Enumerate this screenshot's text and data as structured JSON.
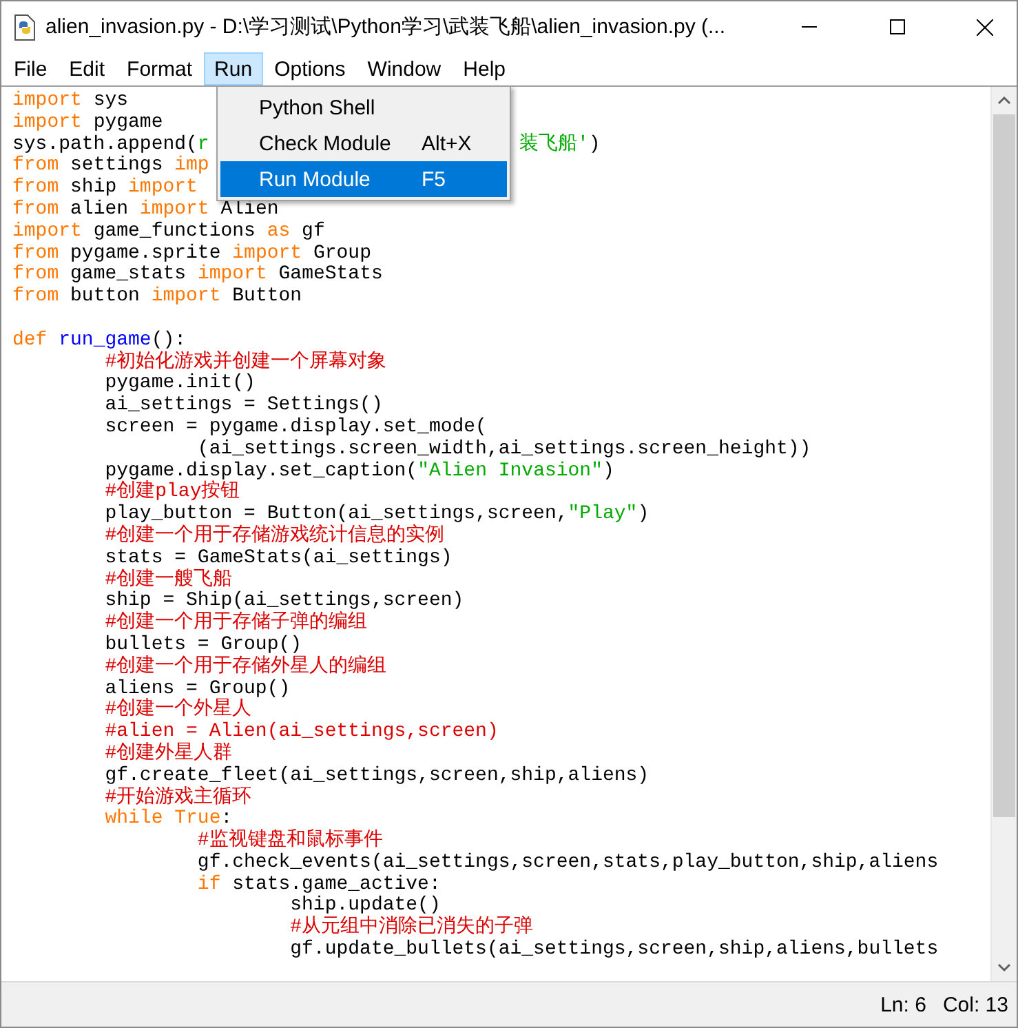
{
  "window": {
    "title": "alien_invasion.py - D:\\学习测试\\Python学习\\武装飞船\\alien_invasion.py (..."
  },
  "menu_bar": [
    {
      "label": "File",
      "selected": false
    },
    {
      "label": "Edit",
      "selected": false
    },
    {
      "label": "Format",
      "selected": false
    },
    {
      "label": "Run",
      "selected": true
    },
    {
      "label": "Options",
      "selected": false
    },
    {
      "label": "Window",
      "selected": false
    },
    {
      "label": "Help",
      "selected": false
    }
  ],
  "run_menu": [
    {
      "label": "Python Shell",
      "selected": false
    },
    {
      "label": "Check Module",
      "shortcut": "Alt+X",
      "selected": false
    },
    {
      "label": "Run Module",
      "shortcut": "F5",
      "selected": true
    }
  ],
  "code_lines": [
    {
      "tokens": [
        {
          "kind": "keyword",
          "text": "import"
        },
        {
          "kind": "plain",
          "text": " sys"
        }
      ]
    },
    {
      "tokens": [
        {
          "kind": "keyword",
          "text": "import"
        },
        {
          "kind": "plain",
          "text": " pygame"
        }
      ]
    },
    {
      "tokens": [
        {
          "kind": "plain",
          "text": "sys.path.append("
        },
        {
          "kind": "string",
          "text": "r"
        }
      ],
      "after_menu": [
        {
          "kind": "string",
          "text": "装飞船'"
        },
        {
          "kind": "plain",
          "text": ")"
        }
      ]
    },
    {
      "tokens": [
        {
          "kind": "keyword",
          "text": "from"
        },
        {
          "kind": "plain",
          "text": " settings "
        },
        {
          "kind": "keyword",
          "text": "imp"
        }
      ]
    },
    {
      "tokens": [
        {
          "kind": "keyword",
          "text": "from"
        },
        {
          "kind": "plain",
          "text": " ship "
        },
        {
          "kind": "keyword",
          "text": "import"
        }
      ]
    },
    {
      "tokens": [
        {
          "kind": "keyword",
          "text": "from"
        },
        {
          "kind": "plain",
          "text": " alien "
        },
        {
          "kind": "keyword",
          "text": "import"
        },
        {
          "kind": "plain",
          "text": " Alien"
        }
      ]
    },
    {
      "tokens": [
        {
          "kind": "keyword",
          "text": "import"
        },
        {
          "kind": "plain",
          "text": " game_functions "
        },
        {
          "kind": "keyword",
          "text": "as"
        },
        {
          "kind": "plain",
          "text": " gf"
        }
      ]
    },
    {
      "tokens": [
        {
          "kind": "keyword",
          "text": "from"
        },
        {
          "kind": "plain",
          "text": " pygame.sprite "
        },
        {
          "kind": "keyword",
          "text": "import"
        },
        {
          "kind": "plain",
          "text": " Group"
        }
      ]
    },
    {
      "tokens": [
        {
          "kind": "keyword",
          "text": "from"
        },
        {
          "kind": "plain",
          "text": " game_stats "
        },
        {
          "kind": "keyword",
          "text": "import"
        },
        {
          "kind": "plain",
          "text": " GameStats"
        }
      ]
    },
    {
      "tokens": [
        {
          "kind": "keyword",
          "text": "from"
        },
        {
          "kind": "plain",
          "text": " button "
        },
        {
          "kind": "keyword",
          "text": "import"
        },
        {
          "kind": "plain",
          "text": " Button"
        }
      ]
    },
    {
      "blank_line_before": true,
      "tokens": [
        {
          "kind": "keyword",
          "text": "def "
        },
        {
          "kind": "definition",
          "text": "run_game"
        },
        {
          "kind": "plain",
          "text": "():"
        }
      ]
    },
    {
      "tokens": [
        {
          "kind": "comment",
          "text": "        #初始化游戏并创建一个屏幕对象"
        }
      ]
    },
    {
      "tokens": [
        {
          "kind": "plain",
          "text": "        pygame.init()"
        }
      ]
    },
    {
      "tokens": [
        {
          "kind": "plain",
          "text": "        ai_settings = Settings()"
        }
      ]
    },
    {
      "tokens": [
        {
          "kind": "plain",
          "text": "        screen = pygame.display.set_mode("
        }
      ]
    },
    {
      "tokens": [
        {
          "kind": "plain",
          "text": "                (ai_settings.screen_width,ai_settings.screen_height))"
        }
      ]
    },
    {
      "tokens": [
        {
          "kind": "plain",
          "text": "        pygame.display.set_caption("
        },
        {
          "kind": "string",
          "text": "\"Alien Invasion\""
        },
        {
          "kind": "plain",
          "text": ")"
        }
      ]
    },
    {
      "tokens": [
        {
          "kind": "comment",
          "text": "        #创建play按钮"
        }
      ]
    },
    {
      "tokens": [
        {
          "kind": "plain",
          "text": "        play_button = Button(ai_settings,screen,"
        },
        {
          "kind": "string",
          "text": "\"Play\""
        },
        {
          "kind": "plain",
          "text": ")"
        }
      ]
    },
    {
      "tokens": [
        {
          "kind": "comment",
          "text": "        #创建一个用于存储游戏统计信息的实例"
        }
      ]
    },
    {
      "tokens": [
        {
          "kind": "plain",
          "text": "        stats = GameStats(ai_settings)"
        }
      ]
    },
    {
      "tokens": [
        {
          "kind": "comment",
          "text": "        #创建一艘飞船"
        }
      ]
    },
    {
      "tokens": [
        {
          "kind": "plain",
          "text": "        ship = Ship(ai_settings,screen)"
        }
      ]
    },
    {
      "tokens": [
        {
          "kind": "comment",
          "text": "        #创建一个用于存储子弹的编组"
        }
      ]
    },
    {
      "tokens": [
        {
          "kind": "plain",
          "text": "        bullets = Group()"
        }
      ]
    },
    {
      "tokens": [
        {
          "kind": "comment",
          "text": "        #创建一个用于存储外星人的编组"
        }
      ]
    },
    {
      "tokens": [
        {
          "kind": "plain",
          "text": "        aliens = Group()"
        }
      ]
    },
    {
      "tokens": [
        {
          "kind": "comment",
          "text": "        #创建一个外星人"
        }
      ]
    },
    {
      "tokens": [
        {
          "kind": "comment",
          "text": "        #alien = Alien(ai_settings,screen)"
        }
      ]
    },
    {
      "tokens": [
        {
          "kind": "comment",
          "text": "        #创建外星人群"
        }
      ]
    },
    {
      "tokens": [
        {
          "kind": "plain",
          "text": "        gf.create_fleet(ai_settings,screen,ship,aliens)"
        }
      ]
    },
    {
      "tokens": [
        {
          "kind": "comment",
          "text": "        #开始游戏主循环"
        }
      ]
    },
    {
      "tokens": [
        {
          "kind": "keyword",
          "text": "        while True"
        },
        {
          "kind": "plain",
          "text": ":"
        }
      ]
    },
    {
      "tokens": [
        {
          "kind": "comment",
          "text": "                #监视键盘和鼠标事件"
        }
      ]
    },
    {
      "tokens": [
        {
          "kind": "plain",
          "text": "                gf.check_events(ai_settings,screen,stats,play_button,ship,aliens"
        }
      ]
    },
    {
      "tokens": [
        {
          "kind": "keyword",
          "text": "                if"
        },
        {
          "kind": "plain",
          "text": " stats.game_active:"
        }
      ]
    },
    {
      "tokens": [
        {
          "kind": "plain",
          "text": "                        ship.update()"
        }
      ]
    },
    {
      "tokens": [
        {
          "kind": "comment",
          "text": "                        #从元组中消除已消失的子弹"
        }
      ]
    },
    {
      "tokens": [
        {
          "kind": "plain",
          "text": "                        gf.update_bullets(ai_settings,screen,ship,aliens,bullets"
        }
      ]
    }
  ],
  "status_bar": {
    "line": "Ln: 6",
    "column": "Col: 13"
  }
}
